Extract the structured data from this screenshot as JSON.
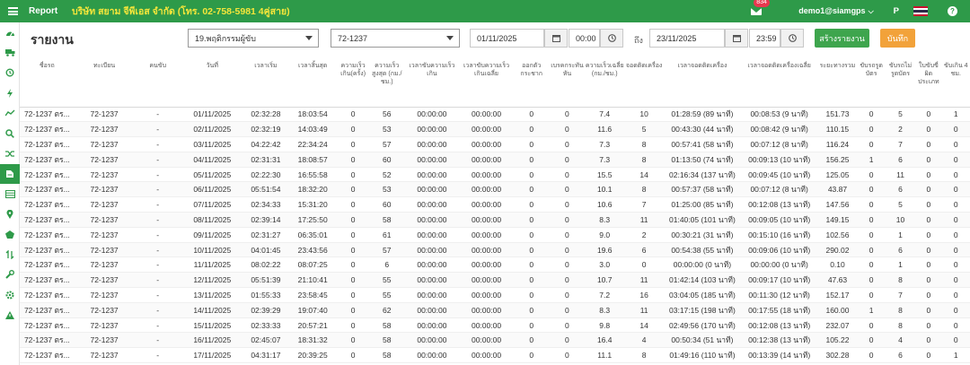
{
  "topbar": {
    "app_name": "Report",
    "company": "บริษัท สยาม จีพีเอส จำกัด (โทร. 02-758-5981 4คู่สาย)",
    "notification_count": "834",
    "user": "demo1@siamgps",
    "lang": "P",
    "help": "?"
  },
  "toolbar": {
    "title": "รายงาน",
    "report_type": "19.พฤติกรรมผู้ขับ",
    "vehicle": "72-1237",
    "date_from": "01/11/2025",
    "time_from": "00:00",
    "to_label": "ถึง",
    "date_to": "23/11/2025",
    "time_to": "23:59",
    "create_label": "สร้างรายงาน",
    "save_label": "บันทึก"
  },
  "table": {
    "columns": [
      "ชื่อรถ",
      "ทะเบียน",
      "คนขับ",
      "วันที่",
      "เวลาเริ่ม",
      "เวลาสิ้นสุด",
      "ความเร็วเกิน(ครั้ง)",
      "ความเร็วสูงสุด (กม./ชม.)",
      "เวลาขับความเร็วเกิน",
      "เวลาขับความเร็วเกินเฉลี่ย",
      "ออกตัวกระชาก",
      "เบรคกระทันหัน",
      "ความเร็วเฉลี่ย (กม./ชม.)",
      "จอดติดเครื่อง",
      "เวลาจอดติดเครื่อง",
      "เวลาจอดติดเครื่องเฉลี่ย",
      "ระยะทางรวม",
      "ขับรถรูดบัตร",
      "ขับรถไม่รูดบัตร",
      "ใบขับขี่ผิดประเภท",
      "ขับเกิน 4 ชม."
    ],
    "rows": [
      [
        "72-1237 ตร...",
        "72-1237",
        "-",
        "01/11/2025",
        "02:32:28",
        "18:03:54",
        "0",
        "56",
        "00:00:00",
        "00:00:00",
        "0",
        "0",
        "7.4",
        "10",
        "01:28:59 (89 นาที)",
        "00:08:53 (9 นาที)",
        "151.73",
        "0",
        "5",
        "0",
        "1"
      ],
      [
        "72-1237 ตร...",
        "72-1237",
        "-",
        "02/11/2025",
        "02:32:19",
        "14:03:49",
        "0",
        "53",
        "00:00:00",
        "00:00:00",
        "0",
        "0",
        "11.6",
        "5",
        "00:43:30 (44 นาที)",
        "00:08:42 (9 นาที)",
        "110.15",
        "0",
        "2",
        "0",
        "0"
      ],
      [
        "72-1237 ตร...",
        "72-1237",
        "-",
        "03/11/2025",
        "04:22:42",
        "22:34:24",
        "0",
        "57",
        "00:00:00",
        "00:00:00",
        "0",
        "0",
        "7.3",
        "8",
        "00:57:41 (58 นาที)",
        "00:07:12 (8 นาที)",
        "116.24",
        "0",
        "7",
        "0",
        "0"
      ],
      [
        "72-1237 ตร...",
        "72-1237",
        "-",
        "04/11/2025",
        "02:31:31",
        "18:08:57",
        "0",
        "60",
        "00:00:00",
        "00:00:00",
        "0",
        "0",
        "7.3",
        "8",
        "01:13:50 (74 นาที)",
        "00:09:13 (10 นาที)",
        "156.25",
        "1",
        "6",
        "0",
        "0"
      ],
      [
        "72-1237 ตร...",
        "72-1237",
        "-",
        "05/11/2025",
        "02:22:30",
        "16:55:58",
        "0",
        "52",
        "00:00:00",
        "00:00:00",
        "0",
        "0",
        "15.5",
        "14",
        "02:16:34 (137 นาที)",
        "00:09:45 (10 นาที)",
        "125.05",
        "0",
        "11",
        "0",
        "0"
      ],
      [
        "72-1237 ตร...",
        "72-1237",
        "-",
        "06/11/2025",
        "05:51:54",
        "18:32:20",
        "0",
        "53",
        "00:00:00",
        "00:00:00",
        "0",
        "0",
        "10.1",
        "8",
        "00:57:37 (58 นาที)",
        "00:07:12 (8 นาที)",
        "43.87",
        "0",
        "6",
        "0",
        "0"
      ],
      [
        "72-1237 ตร...",
        "72-1237",
        "-",
        "07/11/2025",
        "02:34:33",
        "15:31:20",
        "0",
        "60",
        "00:00:00",
        "00:00:00",
        "0",
        "0",
        "10.6",
        "7",
        "01:25:00 (85 นาที)",
        "00:12:08 (13 นาที)",
        "147.56",
        "0",
        "5",
        "0",
        "0"
      ],
      [
        "72-1237 ตร...",
        "72-1237",
        "-",
        "08/11/2025",
        "02:39:14",
        "17:25:50",
        "0",
        "58",
        "00:00:00",
        "00:00:00",
        "0",
        "0",
        "8.3",
        "11",
        "01:40:05 (101 นาที)",
        "00:09:05 (10 นาที)",
        "149.15",
        "0",
        "10",
        "0",
        "0"
      ],
      [
        "72-1237 ตร...",
        "72-1237",
        "-",
        "09/11/2025",
        "02:31:27",
        "06:35:01",
        "0",
        "61",
        "00:00:00",
        "00:00:00",
        "0",
        "0",
        "9.0",
        "2",
        "00:30:21 (31 นาที)",
        "00:15:10 (16 นาที)",
        "102.56",
        "0",
        "1",
        "0",
        "0"
      ],
      [
        "72-1237 ตร...",
        "72-1237",
        "-",
        "10/11/2025",
        "04:01:45",
        "23:43:56",
        "0",
        "57",
        "00:00:00",
        "00:00:00",
        "0",
        "0",
        "19.6",
        "6",
        "00:54:38 (55 นาที)",
        "00:09:06 (10 นาที)",
        "290.02",
        "0",
        "6",
        "0",
        "0"
      ],
      [
        "72-1237 ตร...",
        "72-1237",
        "-",
        "11/11/2025",
        "08:02:22",
        "08:07:25",
        "0",
        "6",
        "00:00:00",
        "00:00:00",
        "0",
        "0",
        "3.0",
        "0",
        "00:00:00 (0 นาที)",
        "00:00:00 (0 นาที)",
        "0.10",
        "0",
        "1",
        "0",
        "0"
      ],
      [
        "72-1237 ตร...",
        "72-1237",
        "-",
        "12/11/2025",
        "05:51:39",
        "21:10:41",
        "0",
        "55",
        "00:00:00",
        "00:00:00",
        "0",
        "0",
        "10.7",
        "11",
        "01:42:14 (103 นาที)",
        "00:09:17 (10 นาที)",
        "47.63",
        "0",
        "8",
        "0",
        "0"
      ],
      [
        "72-1237 ตร...",
        "72-1237",
        "-",
        "13/11/2025",
        "01:55:33",
        "23:58:45",
        "0",
        "55",
        "00:00:00",
        "00:00:00",
        "0",
        "0",
        "7.2",
        "16",
        "03:04:05 (185 นาที)",
        "00:11:30 (12 นาที)",
        "152.17",
        "0",
        "7",
        "0",
        "0"
      ],
      [
        "72-1237 ตร...",
        "72-1237",
        "-",
        "14/11/2025",
        "02:39:29",
        "19:07:40",
        "0",
        "62",
        "00:00:00",
        "00:00:00",
        "0",
        "0",
        "8.3",
        "11",
        "03:17:15 (198 นาที)",
        "00:17:55 (18 นาที)",
        "160.00",
        "1",
        "8",
        "0",
        "0"
      ],
      [
        "72-1237 ตร...",
        "72-1237",
        "-",
        "15/11/2025",
        "02:33:33",
        "20:57:21",
        "0",
        "58",
        "00:00:00",
        "00:00:00",
        "0",
        "0",
        "9.8",
        "14",
        "02:49:56 (170 นาที)",
        "00:12:08 (13 นาที)",
        "232.07",
        "0",
        "8",
        "0",
        "0"
      ],
      [
        "72-1237 ตร...",
        "72-1237",
        "-",
        "16/11/2025",
        "02:45:07",
        "18:31:32",
        "0",
        "58",
        "00:00:00",
        "00:00:00",
        "0",
        "0",
        "16.4",
        "4",
        "00:50:34 (51 นาที)",
        "00:12:38 (13 นาที)",
        "105.22",
        "0",
        "4",
        "0",
        "0"
      ],
      [
        "72-1237 ตร...",
        "72-1237",
        "-",
        "17/11/2025",
        "04:31:17",
        "20:39:25",
        "0",
        "58",
        "00:00:00",
        "00:00:00",
        "0",
        "0",
        "11.1",
        "8",
        "01:49:16 (110 นาที)",
        "00:13:39 (14 นาที)",
        "302.28",
        "0",
        "6",
        "0",
        "1"
      ]
    ]
  },
  "sidebar": {
    "items": [
      "dashboard-icon",
      "truck-icon",
      "history-icon",
      "lightning-icon",
      "chart-line-icon",
      "search-icon",
      "shuffle-icon",
      "report-icon",
      "table-icon",
      "location-icon",
      "polygon-icon",
      "transfer-icon",
      "wrench-icon",
      "settings-icon",
      "alert-icon"
    ],
    "active_index": 7
  },
  "colors": {
    "brand": "#2e9a49",
    "company_text": "#f5e63a",
    "create_button": "#3ea54d",
    "save_button": "#f2a23a",
    "badge": "#e8384f"
  }
}
